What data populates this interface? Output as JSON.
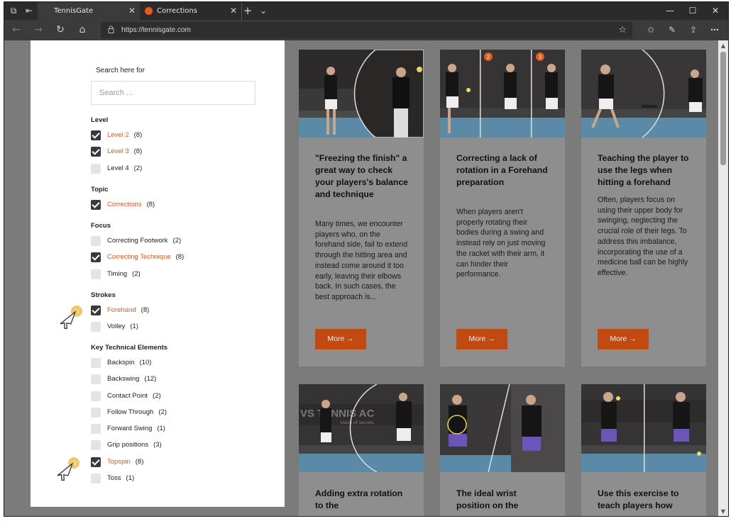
{
  "browser": {
    "tabs": [
      {
        "label": "TennisGate",
        "close": "✕"
      },
      {
        "label": "Corrections",
        "close": "✕"
      }
    ],
    "new_tab": "+",
    "tab_menu": "⌄",
    "window": {
      "minimize": "—",
      "maximize": "☐",
      "close": "✕"
    },
    "nav": {
      "back": "←",
      "forward": "→",
      "refresh": "↻",
      "home": "⌂"
    },
    "url": "https://tennisgate.com",
    "icons": [
      "favorites-star-icon",
      "reading-list-icon",
      "pen-icon",
      "share-icon",
      "more-icon"
    ]
  },
  "sidebar": {
    "search_label": "Search here for",
    "search_placeholder": "Search ...",
    "groups": [
      {
        "title": "Level",
        "options": [
          {
            "name": "Level 2",
            "count": "(8)",
            "checked": true
          },
          {
            "name": "Level 3",
            "count": "(8)",
            "checked": true
          },
          {
            "name": "Level 4",
            "count": "(2)",
            "checked": false
          }
        ]
      },
      {
        "title": "Topic",
        "options": [
          {
            "name": "Corrections",
            "count": "(8)",
            "checked": true
          }
        ]
      },
      {
        "title": "Focus",
        "options": [
          {
            "name": "Correcting Footwork",
            "count": "(2)",
            "checked": false
          },
          {
            "name": "Correcting Technique",
            "count": "(8)",
            "checked": true
          },
          {
            "name": "Timing",
            "count": "(2)",
            "checked": false
          }
        ]
      },
      {
        "title": "Strokes",
        "options": [
          {
            "name": "Forehand",
            "count": "(8)",
            "checked": true
          },
          {
            "name": "Volley",
            "count": "(1)",
            "checked": false
          }
        ]
      },
      {
        "title": "Key Technical Elements",
        "options": [
          {
            "name": "Backspin",
            "count": "(10)",
            "checked": false
          },
          {
            "name": "Backswing",
            "count": "(12)",
            "checked": false
          },
          {
            "name": "Contact Point",
            "count": "(2)",
            "checked": false
          },
          {
            "name": "Follow Through",
            "count": "(2)",
            "checked": false
          },
          {
            "name": "Forward Swing",
            "count": "(1)",
            "checked": false
          },
          {
            "name": "Grip positions",
            "count": "(3)",
            "checked": false
          },
          {
            "name": "Topspin",
            "count": "(8)",
            "checked": true
          },
          {
            "name": "Toss",
            "count": "(1)",
            "checked": false
          }
        ]
      }
    ]
  },
  "cards": [
    {
      "title": "\"Freezing the finish\" a great way to check your players's balance and technique",
      "excerpt": "Many times, we encounter players who, on the forehand side, fail to extend through the hitting area and instead come around it too early, leaving their elbows back. In such cases, the best approach is...",
      "more": "More →"
    },
    {
      "title": "Correcting a lack of rotation in a Forehand preparation",
      "excerpt": "When players aren't properly rotating their bodies during a swing and instead rely on just moving the racket with their arm, it can hinder their performance.",
      "more": "More →"
    },
    {
      "title": "Teaching the player to use the legs when hitting a forehand",
      "excerpt": "Often, players focus on using their upper body for swinging, neglecting the crucial role of their legs. To address this imbalance, incorporating the use of a medicine ball can be highly effective.",
      "more": "More →"
    },
    {
      "title": "Adding extra rotation to the",
      "excerpt": "",
      "more": ""
    },
    {
      "title": "The ideal wrist position on the",
      "excerpt": "",
      "more": ""
    },
    {
      "title": "Use this exercise to teach players how",
      "excerpt": "",
      "more": ""
    }
  ],
  "image_text": {
    "banner_1": "VS TENNIS AC",
    "banner_2": "vision of success",
    "badge_2": "2",
    "badge_3": "3"
  },
  "colors": {
    "accent": "#e4591b",
    "button": "#c14a12",
    "overlay": "#7b7b7b"
  }
}
